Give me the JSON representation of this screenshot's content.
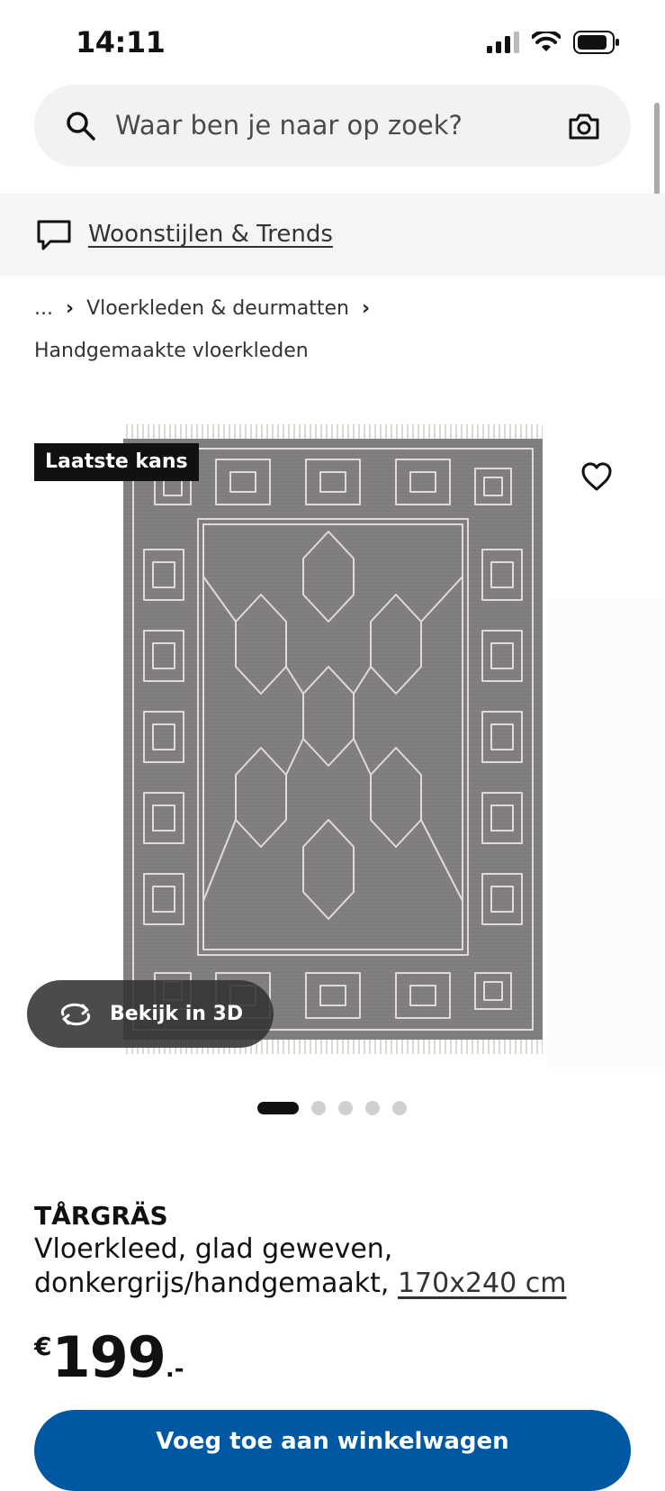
{
  "status_bar": {
    "time": "14:11"
  },
  "search": {
    "placeholder": "Waar ben je naar op zoek?"
  },
  "promo": {
    "link_text": "Woonstijlen & Trends"
  },
  "breadcrumb": {
    "ellipsis": "...",
    "category": "Vloerkleden & deurmatten",
    "subcategory": "Handgemaakte vloerkleden"
  },
  "product_image": {
    "badge": "Laatste kans",
    "view3d_label": "Bekijk in 3D",
    "carousel_count": 5,
    "carousel_active": 1
  },
  "product": {
    "name": "TÅRGRÄS",
    "description": "Vloerkleed, glad geweven, donkergrijs/handgemaakt,",
    "size": "170x240 cm",
    "price_currency": "€",
    "price_amount": "199",
    "price_suffix": ".-"
  },
  "actions": {
    "buy_label": "Voeg toe aan winkelwagen"
  },
  "colors": {
    "brand_blue": "#0058a3",
    "rug_gray": "#7d7b7c"
  },
  "icons": {
    "search": "search-icon",
    "camera": "camera-icon",
    "chat": "chat-bubble-icon",
    "heart": "heart-icon",
    "rotate": "rotate-3d-icon"
  }
}
